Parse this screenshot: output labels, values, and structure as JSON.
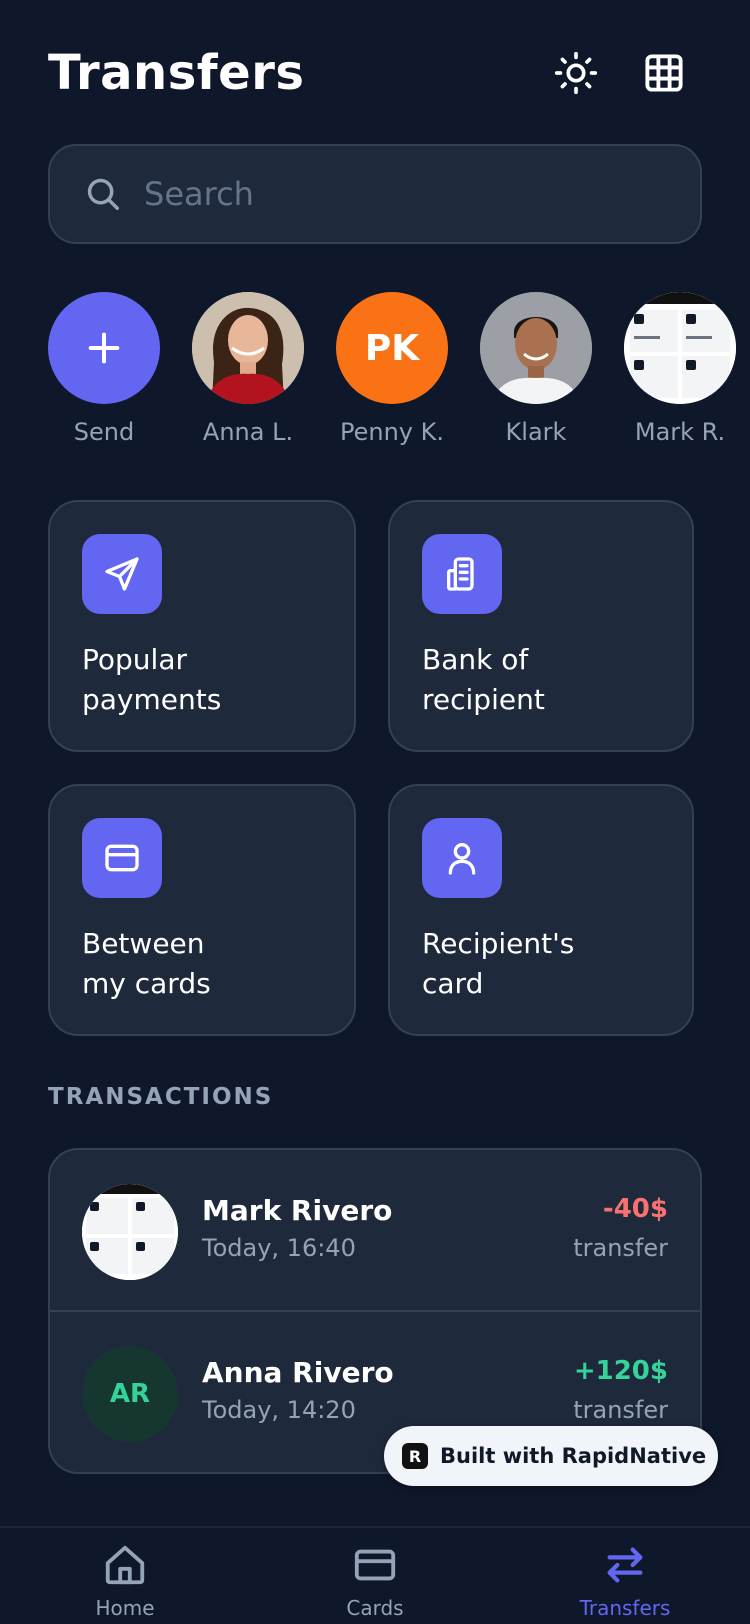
{
  "header": {
    "title": "Transfers"
  },
  "search": {
    "placeholder": "Search"
  },
  "contacts": [
    {
      "name": "Send",
      "type": "add"
    },
    {
      "name": "Anna L.",
      "type": "photo"
    },
    {
      "name": "Penny K.",
      "type": "initials",
      "initials": "PK",
      "color": "#f97316"
    },
    {
      "name": "Klark",
      "type": "photo"
    },
    {
      "name": "Mark R.",
      "type": "screenshot"
    }
  ],
  "actions": [
    {
      "label_line1": "Popular",
      "label_line2": "payments",
      "icon": "send-icon"
    },
    {
      "label_line1": "Bank of",
      "label_line2": "recipient",
      "icon": "bank-building-icon"
    },
    {
      "label_line1": "Between",
      "label_line2": "my cards",
      "icon": "credit-card-icon"
    },
    {
      "label_line1": "Recipient's",
      "label_line2": "card",
      "icon": "user-icon"
    }
  ],
  "transactions_section": {
    "label": "TRANSACTIONS"
  },
  "transactions": [
    {
      "name": "Mark Rivero",
      "time": "Today, 16:40",
      "amount": "-40$",
      "type": "transfer",
      "direction": "out"
    },
    {
      "name": "Anna Rivero",
      "time": "Today, 14:20",
      "amount": "+120$",
      "type": "transfer",
      "direction": "in",
      "initials": "AR"
    }
  ],
  "badge": {
    "text": "Built with RapidNative"
  },
  "tabs": [
    {
      "label": "Home",
      "icon": "home-icon",
      "active": false
    },
    {
      "label": "Cards",
      "icon": "credit-card-icon",
      "active": false
    },
    {
      "label": "Transfers",
      "icon": "swap-arrows-icon",
      "active": true
    }
  ],
  "colors": {
    "background": "#0f172a",
    "surface": "#1e293b",
    "border": "#334155",
    "accent": "#6366f1",
    "negative": "#f87171",
    "positive": "#34d399",
    "muted": "#94a3b8"
  }
}
